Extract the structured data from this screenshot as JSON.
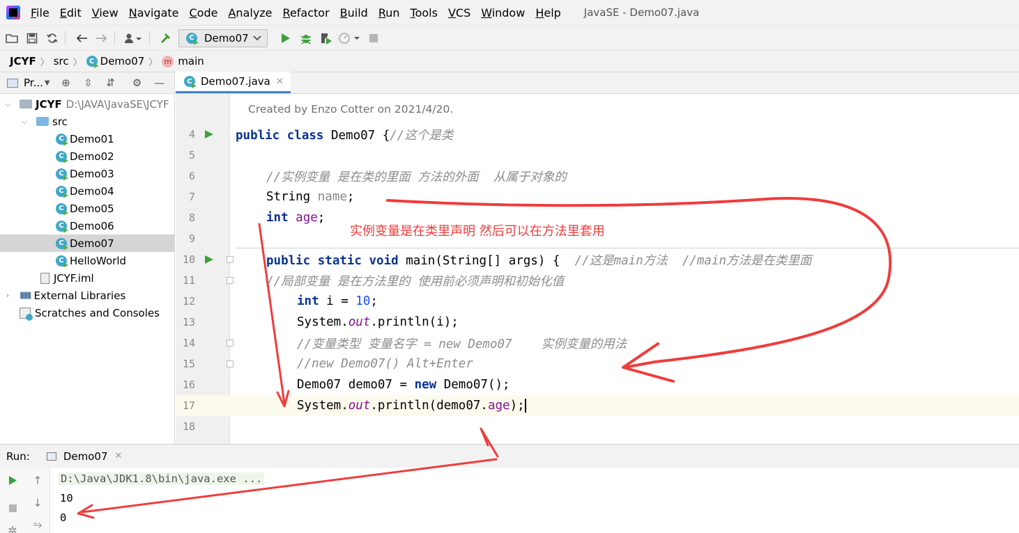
{
  "menu": {
    "items": [
      "File",
      "Edit",
      "View",
      "Navigate",
      "Code",
      "Analyze",
      "Refactor",
      "Build",
      "Run",
      "Tools",
      "VCS",
      "Window",
      "Help"
    ],
    "window_title": "JavaSE - Demo07.java"
  },
  "toolbar": {
    "run_config": "Demo07"
  },
  "breadcrumb": {
    "items": [
      "JCYF",
      "src",
      "Demo07",
      "main"
    ]
  },
  "project_panel": {
    "title": "Pr...",
    "root_name": "JCYF",
    "root_path": "D:\\JAVA\\JavaSE\\JCYF",
    "src": "src",
    "classes": [
      "Demo01",
      "Demo02",
      "Demo03",
      "Demo04",
      "Demo05",
      "Demo06",
      "Demo07",
      "HelloWorld"
    ],
    "selected": "Demo07",
    "iml": "JCYF.iml",
    "external_libraries": "External Libraries",
    "scratches": "Scratches and Consoles"
  },
  "editor": {
    "tab_label": "Demo07.java",
    "doc_comment": "Created by Enzo Cotter on 2021/4/20.",
    "line_numbers": [
      "4",
      "5",
      "6",
      "7",
      "8",
      "9",
      "10",
      "11",
      "12",
      "13",
      "14",
      "15",
      "16",
      "17",
      "18"
    ],
    "lines": {
      "l4_kw": "public class",
      "l4_rest": " Demo07 {",
      "l4_cm": "//这个是类",
      "l6_cm": "//实例变量 是在类的里面 方法的外面  从属于对象的",
      "l7_type": "String",
      "l7_field": "name",
      "l7_end": ";",
      "l8_kw": "int",
      "l8_field": "age",
      "l8_end": ";",
      "l10_kw": "public static void",
      "l10_rest": " main(String[] args) {  ",
      "l10_cm": "//这是main方法  //main方法是在类里面",
      "l11_cm": "//局部变量 是在方法里的 使用前必须声明和初始化值",
      "l12_kw": "int",
      "l12_rest": " i = ",
      "l12_num": "10",
      "l12_end": ";",
      "l13_a": "System.",
      "l13_out": "out",
      "l13_b": ".println(i);",
      "l14_cm": "//变量类型 变量名字 = new Demo07    实例变量的用法",
      "l15_cm": "//new Demo07() Alt+Enter",
      "l16_a": "Demo07 demo07 = ",
      "l16_kw": "new",
      "l16_b": " Demo07();",
      "l17_a": "System.",
      "l17_out": "out",
      "l17_b": ".println(demo07.",
      "l17_field": "age",
      "l17_end": ");"
    }
  },
  "annotation": {
    "text": "实例变量是在类里声明 然后可以在方法里套用",
    "color": "#f03c3c"
  },
  "run_panel": {
    "label": "Run:",
    "tab": "Demo07",
    "output": [
      "D:\\Java\\JDK1.8\\bin\\java.exe ...",
      "10",
      "0"
    ]
  }
}
